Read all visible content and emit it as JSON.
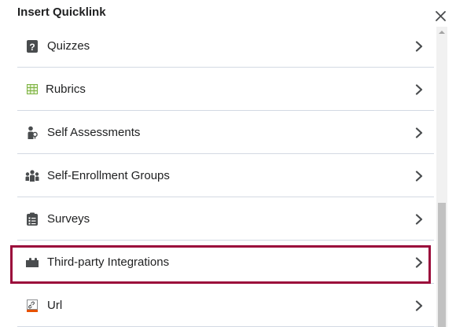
{
  "dialog": {
    "title": "Insert Quicklink",
    "close_icon": "close-icon"
  },
  "items": [
    {
      "label": "Quizzes",
      "icon": "quiz-icon"
    },
    {
      "label": "Rubrics",
      "icon": "rubric-grid-icon"
    },
    {
      "label": "Self Assessments",
      "icon": "self-assessment-icon"
    },
    {
      "label": "Self-Enrollment Groups",
      "icon": "groups-icon"
    },
    {
      "label": "Surveys",
      "icon": "survey-icon"
    },
    {
      "label": "Third-party Integrations",
      "icon": "puzzle-icon",
      "highlighted": true
    },
    {
      "label": "Url",
      "icon": "url-link-icon"
    }
  ],
  "colors": {
    "highlight_border": "#9b0b3b",
    "divider": "#d3d9e3",
    "text": "#202122",
    "rubric_icon": "#7cb342",
    "url_icon_accent": "#e65100"
  }
}
